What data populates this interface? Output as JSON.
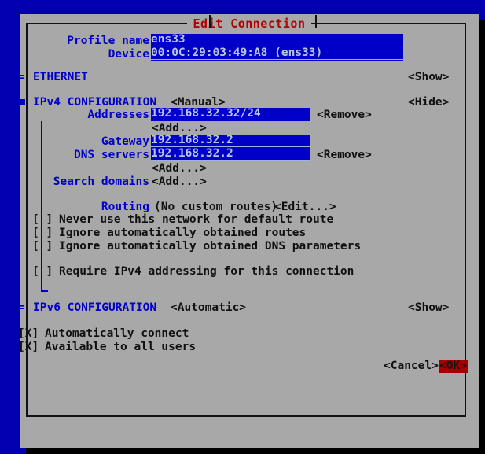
{
  "window": {
    "title": "Edit Connection",
    "background_color": "#0000b0",
    "dialog_color": "#a8a8a8",
    "title_color": "#b00000",
    "label_color": "#0000c8",
    "entry_color": "#0000c8",
    "ok_highlight_color": "#a40000"
  },
  "fields": {
    "profile_name": {
      "label": "Profile name",
      "value": "ens33"
    },
    "device": {
      "label": "Device",
      "value": "00:0C:29:03:49:A8 (ens33)"
    }
  },
  "sections": {
    "ethernet": {
      "marker": "=",
      "label": "ETHERNET",
      "toggle": "<Show>"
    },
    "ipv4": {
      "marker": "square",
      "label": "IPv4 CONFIGURATION",
      "mode": "<Manual>",
      "toggle": "<Hide>",
      "addresses": {
        "label": "Addresses",
        "values": [
          "192.168.32.32/24"
        ],
        "remove_label": "<Remove>",
        "add_label": "<Add...>"
      },
      "gateway": {
        "label": "Gateway",
        "value": "192.168.32.2"
      },
      "dns_servers": {
        "label": "DNS servers",
        "values": [
          "192.168.32.2"
        ],
        "remove_label": "<Remove>",
        "add_label": "<Add...>"
      },
      "search_domains": {
        "label": "Search domains",
        "add_label": "<Add...>"
      },
      "routing": {
        "label": "Routing",
        "status": "(No custom routes)",
        "edit_label": "<Edit...>"
      },
      "checkboxes": [
        {
          "mark": "[ ]",
          "label": "Never use this network for default route",
          "checked": false
        },
        {
          "mark": "[ ]",
          "label": "Ignore automatically obtained routes",
          "checked": false
        },
        {
          "mark": "[ ]",
          "label": "Ignore automatically obtained DNS parameters",
          "checked": false
        }
      ],
      "require_ipv4": {
        "mark": "[ ]",
        "label": "Require IPv4 addressing for this connection",
        "checked": false
      }
    },
    "ipv6": {
      "marker": "=",
      "label": "IPv6 CONFIGURATION",
      "mode": "<Automatic>",
      "toggle": "<Show>"
    }
  },
  "global_checkboxes": [
    {
      "mark": "[X]",
      "label": "Automatically connect",
      "checked": true
    },
    {
      "mark": "[X]",
      "label": "Available to all users",
      "checked": true
    }
  ],
  "buttons": {
    "cancel": "<Cancel>",
    "ok": "<OK>"
  }
}
